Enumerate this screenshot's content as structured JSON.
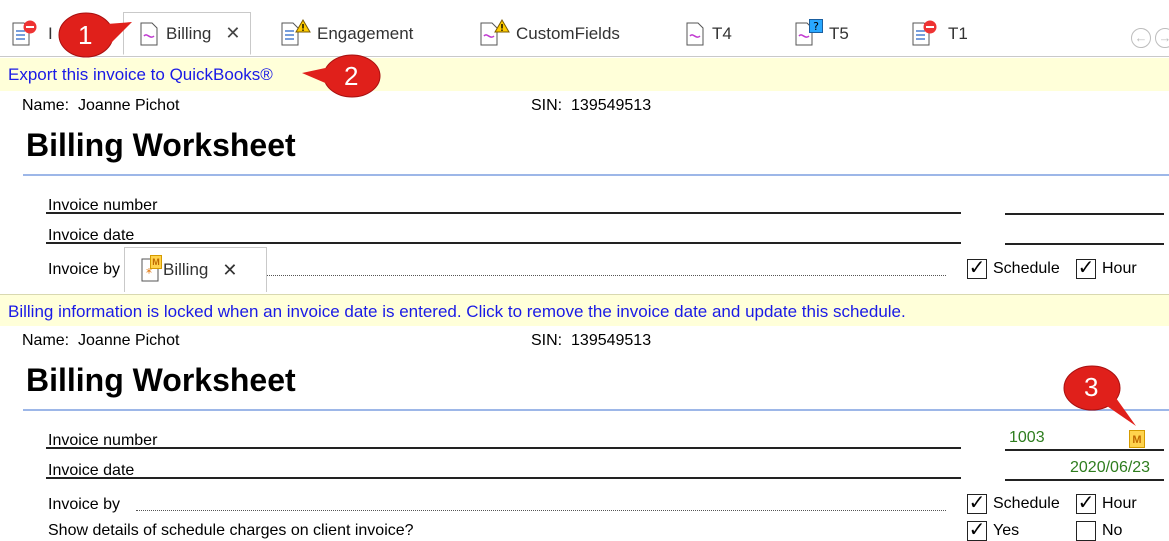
{
  "tabs": [
    {
      "label": "I",
      "badge": "stop"
    },
    {
      "label": "Billing",
      "badge": "none",
      "active": true,
      "close": "✕"
    },
    {
      "label": "Engagement",
      "badge": "warning"
    },
    {
      "label": "CustomFields",
      "badge": "warning"
    },
    {
      "label": "T4",
      "badge": "none"
    },
    {
      "label": "T5",
      "badge": "question"
    },
    {
      "label": "T1",
      "badge": "stop"
    }
  ],
  "nav": {
    "back": "←",
    "forward": "→"
  },
  "export_link": "Export this invoice to QuickBooks®",
  "lock_message": "Billing information is locked when an invoice date is entered. Click to remove the invoice date and update this schedule.",
  "inner_tab": {
    "label": "Billing",
    "close": "✕",
    "badge": "M"
  },
  "sheet": {
    "name_label": "Name:",
    "name_value": "Joanne Pichot",
    "sin_label": "SIN:",
    "sin_value": "139549513",
    "title": "Billing Worksheet",
    "invoice_number_label": "Invoice number",
    "invoice_date_label": "Invoice date",
    "invoice_by_label": "Invoice by",
    "schedule_label": "Schedule",
    "hour_label": "Hour",
    "show_details_label": "Show details of schedule charges on client invoice?",
    "yes_label": "Yes",
    "no_label": "No",
    "check_mark": "✓"
  },
  "values": {
    "invoice_number": "1003",
    "invoice_date": "2020/06/23",
    "override_badge": "M"
  },
  "callouts": [
    "1",
    "2",
    "3"
  ],
  "colors": {
    "link": "#1a1ae6",
    "info_bg": "#ffffd9",
    "callout": "#e0201b",
    "green_value": "#2e7d1e"
  }
}
